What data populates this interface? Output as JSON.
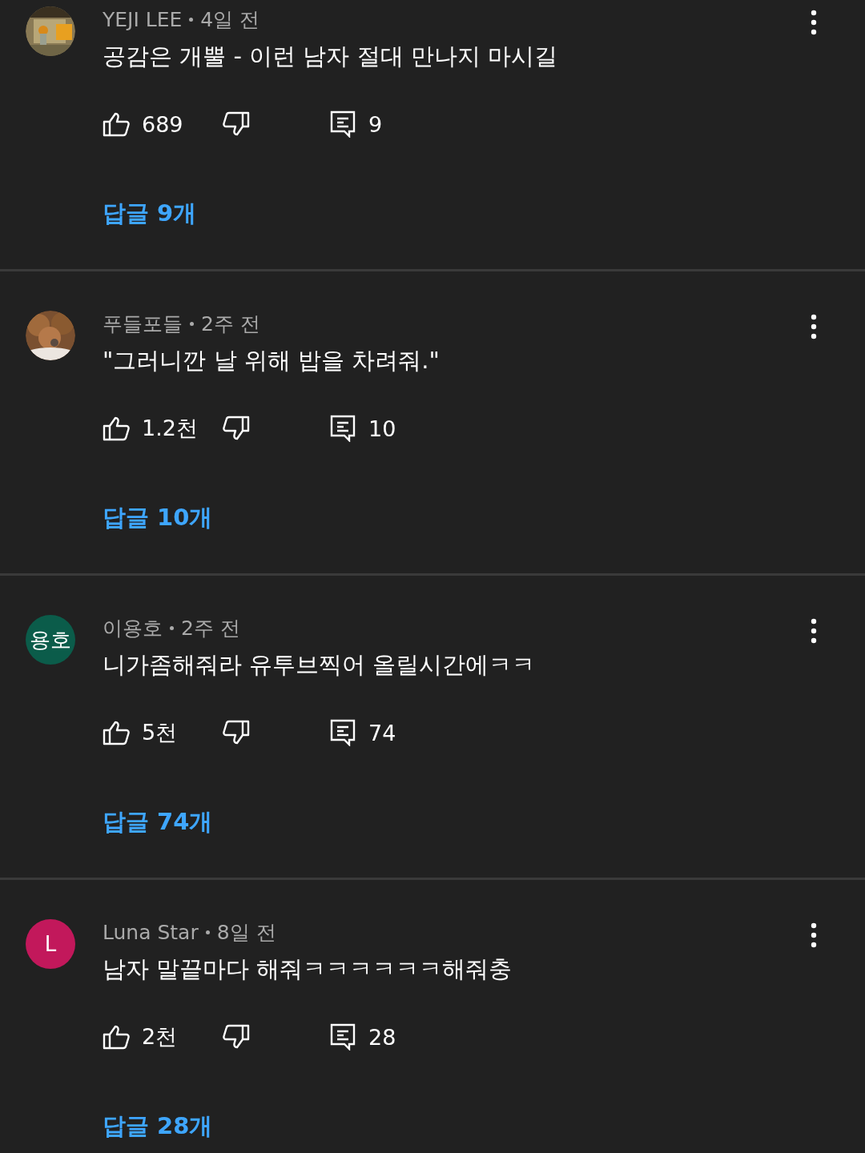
{
  "comments": [
    {
      "author": "YEJI LEE",
      "time": "4일 전",
      "text": "공감은 개뿔 - 이런 남자 절대 만나지 마시길",
      "likes": "689",
      "reply_count": "9",
      "replies_link": "답글 9개"
    },
    {
      "author": "푸들포들",
      "time": "2주 전",
      "text": "\"그러니깐 날 위해 밥을 차려줘.\"",
      "likes": "1.2천",
      "reply_count": "10",
      "replies_link": "답글 10개"
    },
    {
      "avatar": {
        "kind": "initials",
        "text": "용호",
        "color": "#0b5c4a"
      },
      "author": "이용호",
      "time": "2주 전",
      "text": "니가좀해줘라 유투브찍어 올릴시간에ㅋㅋ",
      "likes": "5천",
      "reply_count": "74",
      "replies_link": "답글 74개"
    },
    {
      "avatar": {
        "kind": "initials",
        "text": "L",
        "color": "#c2185b"
      },
      "author": "Luna Star",
      "time": "8일 전",
      "text": "남자 말끝마다 해줘ㅋㅋㅋㅋㅋㅋ해줘충",
      "likes": "2천",
      "reply_count": "28",
      "replies_link": "답글 28개"
    }
  ]
}
